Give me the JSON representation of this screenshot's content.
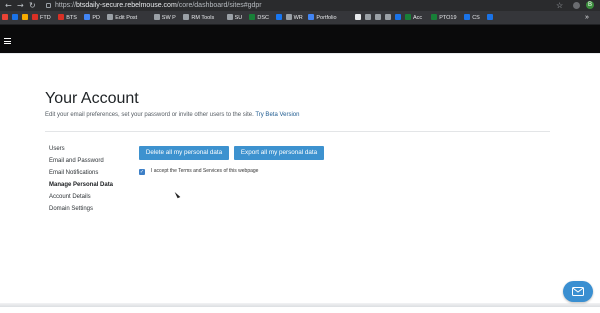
{
  "browser": {
    "url_prefix": "https://",
    "url_host": "btsdaily-secure.rebelmouse.com",
    "url_path": "/core/dashboard/sites#gdpr",
    "back": "←",
    "forward": "→",
    "reload": "↻",
    "star": "☆",
    "avatar_letter": "B",
    "more": "»"
  },
  "bookmarks": [
    {
      "label": "",
      "color": "#ea4335"
    },
    {
      "label": "",
      "color": "#1a73e8"
    },
    {
      "label": "",
      "color": "#f9ab00"
    },
    {
      "label": "FTD",
      "color": "#d93025"
    },
    {
      "label": "BTS",
      "color": "#d93025"
    },
    {
      "label": "PD",
      "color": "#4285f4"
    },
    {
      "label": "Edit Post",
      "color": "#9aa0a6"
    },
    {
      "label": "SW P",
      "color": "#9aa0a6"
    },
    {
      "label": "RM Tools",
      "color": "#9aa0a6"
    },
    {
      "label": "SU",
      "color": "#9aa0a6"
    },
    {
      "label": "DSC",
      "color": "#188038"
    },
    {
      "label": "",
      "color": "#1877f2"
    },
    {
      "label": "WR",
      "color": "#9aa0a6"
    },
    {
      "label": "Portfolio",
      "color": "#4285f4"
    },
    {
      "label": "",
      "color": "#e8eaed"
    },
    {
      "label": "",
      "color": "#9aa0a6"
    },
    {
      "label": "",
      "color": "#9aa0a6"
    },
    {
      "label": "",
      "color": "#9aa0a6"
    },
    {
      "label": "",
      "color": "#1a73e8"
    },
    {
      "label": "Acc",
      "color": "#188038"
    },
    {
      "label": "PTO19",
      "color": "#188038"
    },
    {
      "label": "CS",
      "color": "#1a73e8"
    },
    {
      "label": "",
      "color": "#1a73e8"
    }
  ],
  "page": {
    "title": "Your Account",
    "subtitle": "Edit your email preferences, set your password or invite other users to the site.",
    "beta_link": "Try Beta Version"
  },
  "sidebar": {
    "items": [
      {
        "label": "Users"
      },
      {
        "label": "Email and Password"
      },
      {
        "label": "Email Notifications"
      },
      {
        "label": "Manage Personal Data",
        "active": true
      },
      {
        "label": "Account Details"
      },
      {
        "label": "Domain Settings"
      }
    ]
  },
  "actions": {
    "delete_label": "Delete all my personal data",
    "export_label": "Export all my personal data"
  },
  "terms": {
    "checked": true,
    "check_mark": "✓",
    "label": "I accept the Terms and Services of this webpage"
  },
  "colors": {
    "button": "#3d92cf",
    "appbar": "#0a0a0b",
    "link": "#1d5a8f"
  }
}
